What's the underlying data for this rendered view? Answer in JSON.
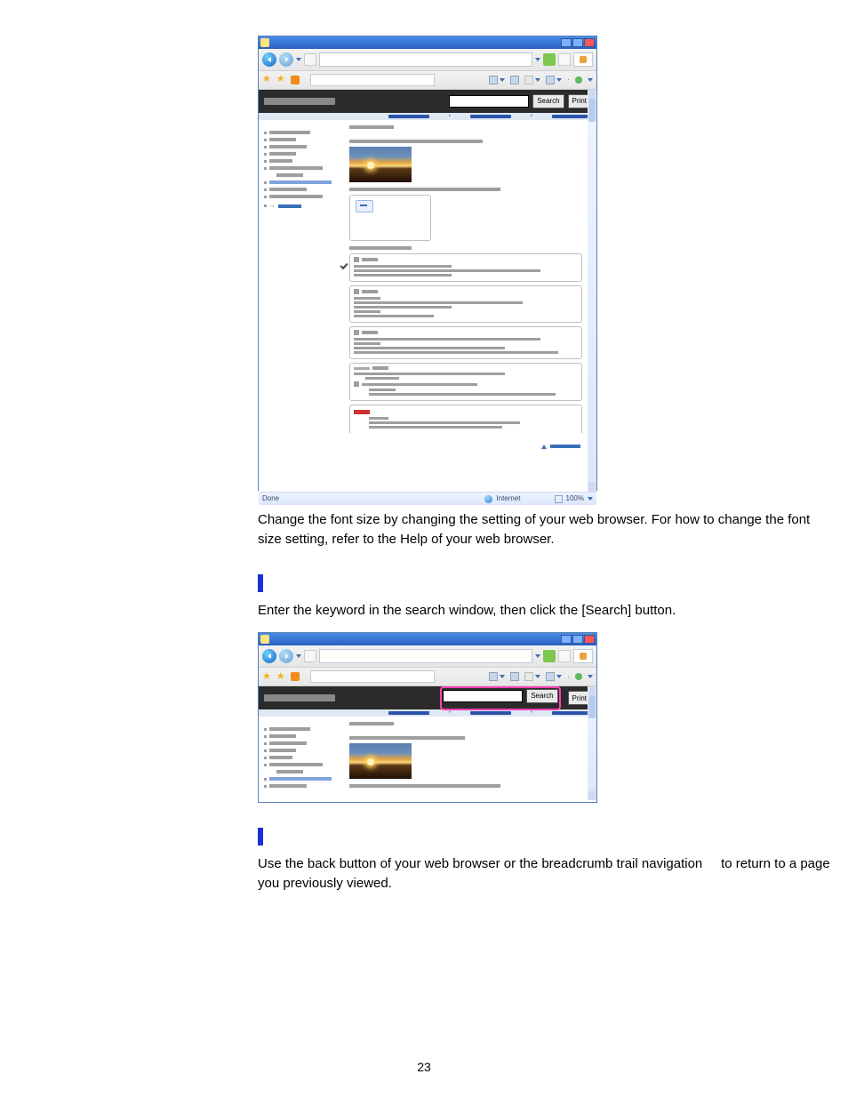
{
  "browser": {
    "buttons": {
      "search": "Search",
      "print": "Print"
    },
    "status": {
      "done": "Done",
      "zone": "Internet",
      "zoom": "100%"
    },
    "search_placeholder": ""
  },
  "text": {
    "para1": "Change the font size by changing the setting of your web browser. For how to change the font size setting, refer to the Help of your web browser.",
    "para2": "Enter the keyword in the search window, then click the [Search] button.",
    "para3a": "Use the back button of your web browser or the breadcrumb trail navigation",
    "para3b": "to return to a page you previously viewed."
  },
  "page_number": "23"
}
